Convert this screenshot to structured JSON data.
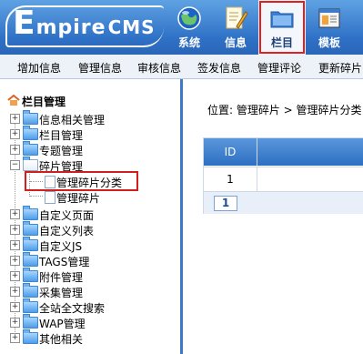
{
  "header": {
    "logo_big": "E",
    "logo_rest": "mpire",
    "logo_cms": "CMS",
    "nav": [
      {
        "label": "系统",
        "icon": "globe-icon"
      },
      {
        "label": "信息",
        "icon": "document-pencil-icon"
      },
      {
        "label": "栏目",
        "icon": "folder-icon",
        "active": true
      },
      {
        "label": "模板",
        "icon": "window-template-icon"
      }
    ]
  },
  "menubar": {
    "items": [
      "增加信息",
      "管理信息",
      "审核信息",
      "签发信息",
      "管理评论",
      "更新碎片"
    ]
  },
  "sidebar": {
    "title": "栏目管理",
    "items": [
      "信息相关管理",
      "栏目管理",
      "专题管理",
      "碎片管理",
      "管理碎片分类",
      "管理碎片",
      "自定义页面",
      "自定义列表",
      "自定义JS",
      "TAGS管理",
      "附件管理",
      "采集管理",
      "全站全文搜索",
      "WAP管理",
      "其他相关"
    ]
  },
  "main": {
    "breadcrumb": "位置: 管理碎片 > 管理碎片分类",
    "table": {
      "header_id": "ID",
      "rows": [
        {
          "id": "1"
        }
      ],
      "page": "1"
    }
  },
  "colors": {
    "header_blue": "#2f71c6",
    "highlight_red": "#d31e1e",
    "menubar_bg": "#edf2f8"
  }
}
